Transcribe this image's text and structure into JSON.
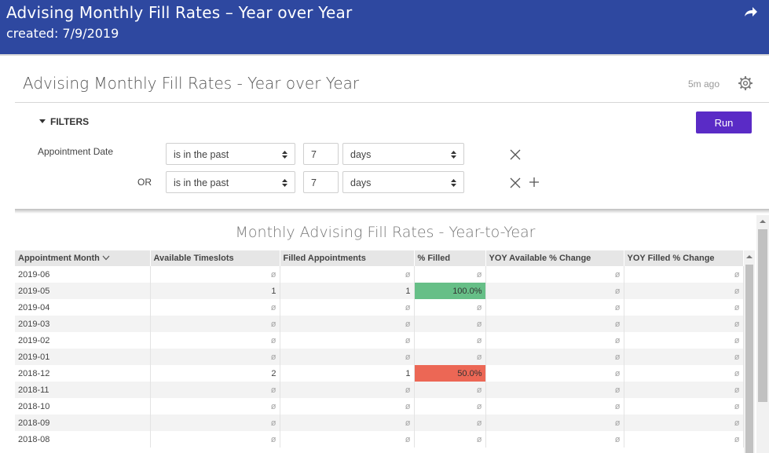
{
  "header": {
    "title": "Advising Monthly Fill Rates – Year over Year",
    "created": "created: 7/9/2019"
  },
  "card": {
    "title": "Advising Monthly Fill Rates - Year over Year",
    "updated": "5m ago"
  },
  "filters": {
    "toggle_label": "FILTERS",
    "run_label": "Run",
    "field_label": "Appointment Date",
    "or_label": "OR",
    "rows": [
      {
        "condition": "is in the past",
        "value": "7",
        "unit": "days"
      },
      {
        "condition": "is in the past",
        "value": "7",
        "unit": "days"
      }
    ]
  },
  "viz": {
    "title": "Monthly Advising Fill Rates - Year-to-Year",
    "columns": [
      "Appointment Month",
      "Available Timeslots",
      "Filled Appointments",
      "% Filled",
      "YOY Available % Change",
      "YOY Filled % Change"
    ],
    "null_symbol": "ø",
    "rows": [
      [
        "2019-06",
        "ø",
        "ø",
        "ø",
        "ø",
        "ø"
      ],
      [
        "2019-05",
        "1",
        "1",
        "100.0%",
        "ø",
        "ø"
      ],
      [
        "2019-04",
        "ø",
        "ø",
        "ø",
        "ø",
        "ø"
      ],
      [
        "2019-03",
        "ø",
        "ø",
        "ø",
        "ø",
        "ø"
      ],
      [
        "2019-02",
        "ø",
        "ø",
        "ø",
        "ø",
        "ø"
      ],
      [
        "2019-01",
        "ø",
        "ø",
        "ø",
        "ø",
        "ø"
      ],
      [
        "2018-12",
        "2",
        "1",
        "50.0%",
        "ø",
        "ø"
      ],
      [
        "2018-11",
        "ø",
        "ø",
        "ø",
        "ø",
        "ø"
      ],
      [
        "2018-10",
        "ø",
        "ø",
        "ø",
        "ø",
        "ø"
      ],
      [
        "2018-09",
        "ø",
        "ø",
        "ø",
        "ø",
        "ø"
      ],
      [
        "2018-08",
        "ø",
        "ø",
        "ø",
        "ø",
        "ø"
      ]
    ],
    "highlight_colors": {
      "high": "#66bf87",
      "low": "#ec6755"
    }
  },
  "colors": {
    "header_bg": "#2e48a0",
    "run_button": "#5a2bc6"
  },
  "icons": {
    "share": "share-arrow-icon",
    "settings": "gear-icon",
    "remove": "close-icon",
    "add": "plus-icon",
    "sort": "chevron-down-icon"
  }
}
